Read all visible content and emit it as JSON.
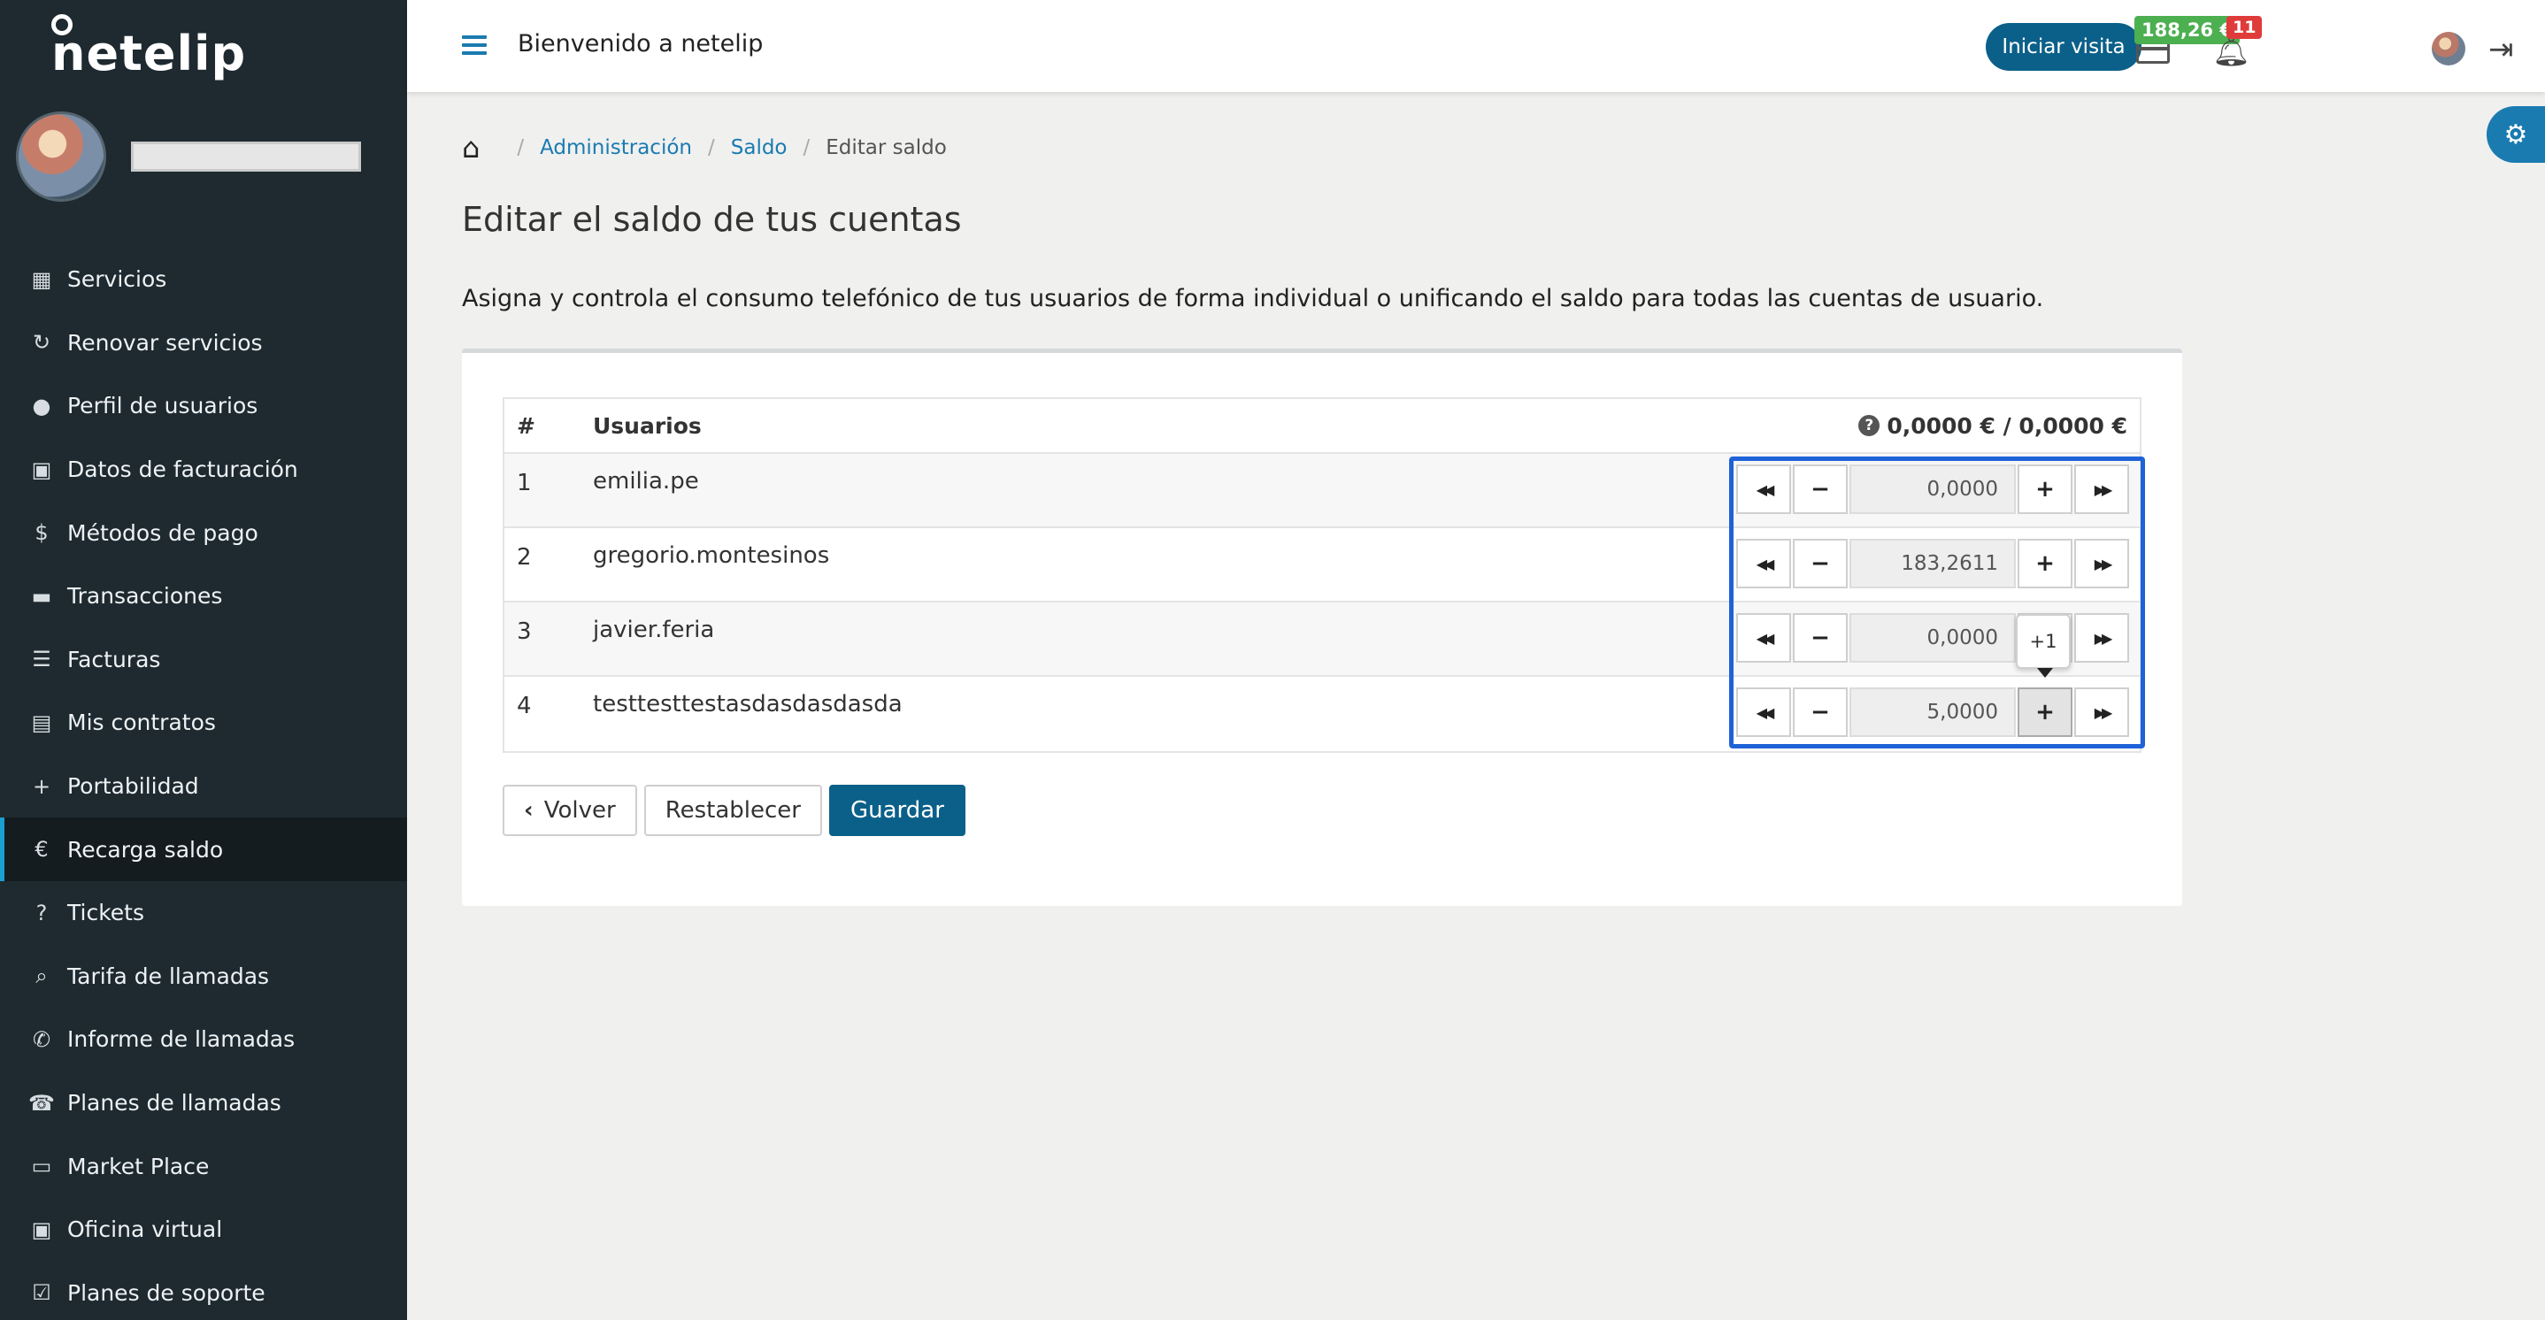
{
  "app": {
    "logo": "netelip"
  },
  "sidebar": {
    "items": [
      {
        "label": "Servicios",
        "icon": "grid-icon",
        "glyph": "▦"
      },
      {
        "label": "Renovar servicios",
        "icon": "refresh-icon",
        "glyph": "↻"
      },
      {
        "label": "Perfil de usuarios",
        "icon": "user-icon",
        "glyph": "●"
      },
      {
        "label": "Datos de facturación",
        "icon": "briefcase-icon",
        "glyph": "▣"
      },
      {
        "label": "Métodos de pago",
        "icon": "dollar-icon",
        "glyph": "$"
      },
      {
        "label": "Transacciones",
        "icon": "credit-card-icon",
        "glyph": "▬"
      },
      {
        "label": "Facturas",
        "icon": "list-icon",
        "glyph": "☰"
      },
      {
        "label": "Mis contratos",
        "icon": "file-icon",
        "glyph": "▤"
      },
      {
        "label": "Portabilidad",
        "icon": "plus-icon",
        "glyph": "+"
      },
      {
        "label": "Recarga saldo",
        "icon": "euro-icon",
        "glyph": "€",
        "active": true
      },
      {
        "label": "Tickets",
        "icon": "question-icon",
        "glyph": "?"
      },
      {
        "label": "Tarifa de llamadas",
        "icon": "search-icon",
        "glyph": "⌕"
      },
      {
        "label": "Informe de llamadas",
        "icon": "phone-icon",
        "glyph": "✆"
      },
      {
        "label": "Planes de llamadas",
        "icon": "telephone-icon",
        "glyph": "☎"
      },
      {
        "label": "Market Place",
        "icon": "presentation-icon",
        "glyph": "▭"
      },
      {
        "label": "Oficina virtual",
        "icon": "briefcase-icon",
        "glyph": "▣"
      },
      {
        "label": "Planes de soporte",
        "icon": "check-square-icon",
        "glyph": "☑"
      }
    ]
  },
  "topbar": {
    "welcome": "Bienvenido a netelip",
    "visit_button": "Iniciar visita",
    "balance": "188,26 €",
    "notifications": "11"
  },
  "breadcrumb": {
    "items": [
      "Administración",
      "Saldo"
    ],
    "current": "Editar saldo"
  },
  "page": {
    "title": "Editar el saldo de tus cuentas",
    "description": "Asigna y controla el consumo telefónico de tus usuarios de forma individual o unificando el saldo para todas las cuentas de usuario."
  },
  "table": {
    "headers": {
      "num": "#",
      "users": "Usuarios",
      "total": "0,0000 € / 0,0000 €"
    },
    "rows": [
      {
        "num": "1",
        "user": "emilia.pe",
        "value": "0,0000"
      },
      {
        "num": "2",
        "user": "gregorio.montesinos",
        "value": "183,2611"
      },
      {
        "num": "3",
        "user": "javier.feria",
        "value": "0,0000"
      },
      {
        "num": "4",
        "user": "testtesttestasdasdasdasda",
        "value": "5,0000"
      }
    ]
  },
  "tooltip": "+1",
  "actions": {
    "back": "Volver",
    "reset": "Restablecer",
    "save": "Guardar"
  }
}
